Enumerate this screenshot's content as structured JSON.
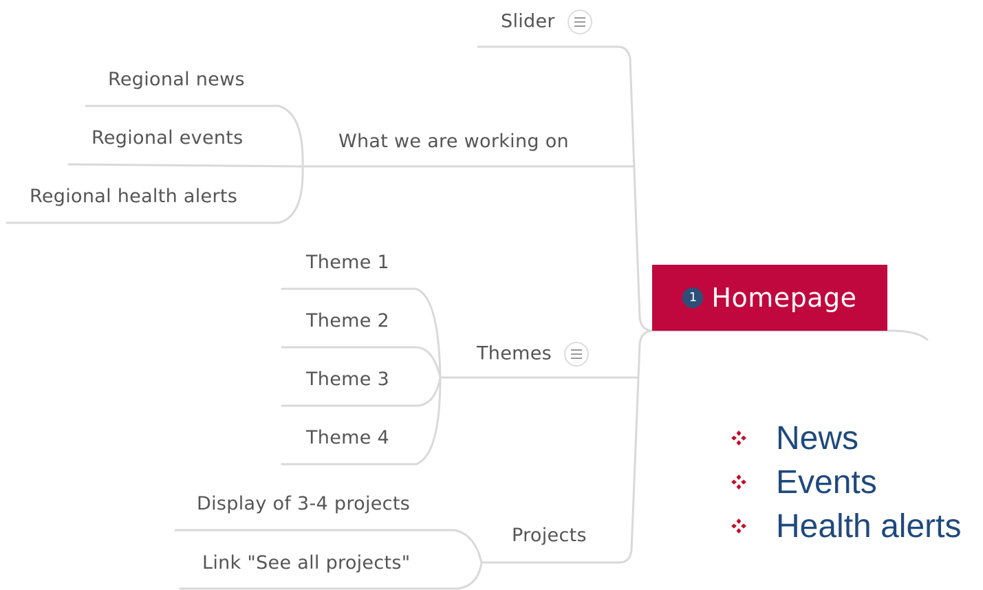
{
  "root": {
    "badge": "1",
    "label": "Homepage",
    "color": "#c0083f",
    "badge_color": "#2c4f7a"
  },
  "branches": {
    "slider": "Slider",
    "working_on": "What we are working on",
    "themes": "Themes",
    "projects": "Projects"
  },
  "working_on_children": [
    "Regional news",
    "Regional events",
    "Regional health alerts"
  ],
  "themes_children": [
    "Theme 1",
    "Theme 2",
    "Theme 3",
    "Theme 4"
  ],
  "projects_children": [
    "Display of 3-4 projects",
    "Link \"See all projects\""
  ],
  "bullets": [
    "News",
    "Events",
    "Health alerts"
  ],
  "colors": {
    "line": "#d9d9d9",
    "node_text": "#555555",
    "bullet_text": "#1f497d",
    "bullet_marker": "#c0102a"
  },
  "icons": {
    "notes": "notes-icon",
    "bullet": "diamond-bullet-icon"
  }
}
